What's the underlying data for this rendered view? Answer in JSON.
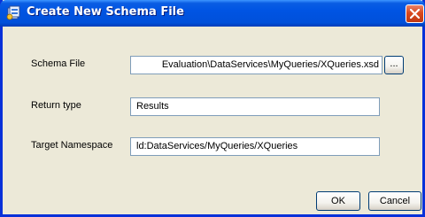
{
  "window": {
    "title": "Create New Schema File",
    "icon": "schema-file-icon",
    "close_icon": "close-icon"
  },
  "form": {
    "schema_file_label": "Schema File",
    "schema_file_value": "Evaluation\\DataServices\\MyQueries/XQueries.xsd",
    "browse_label": "...",
    "return_type_label": "Return type",
    "return_type_value": "Results",
    "target_namespace_label": "Target Namespace",
    "target_namespace_value": "ld:DataServices/MyQueries/XQueries"
  },
  "buttons": {
    "ok_label": "OK",
    "cancel_label": "Cancel"
  }
}
